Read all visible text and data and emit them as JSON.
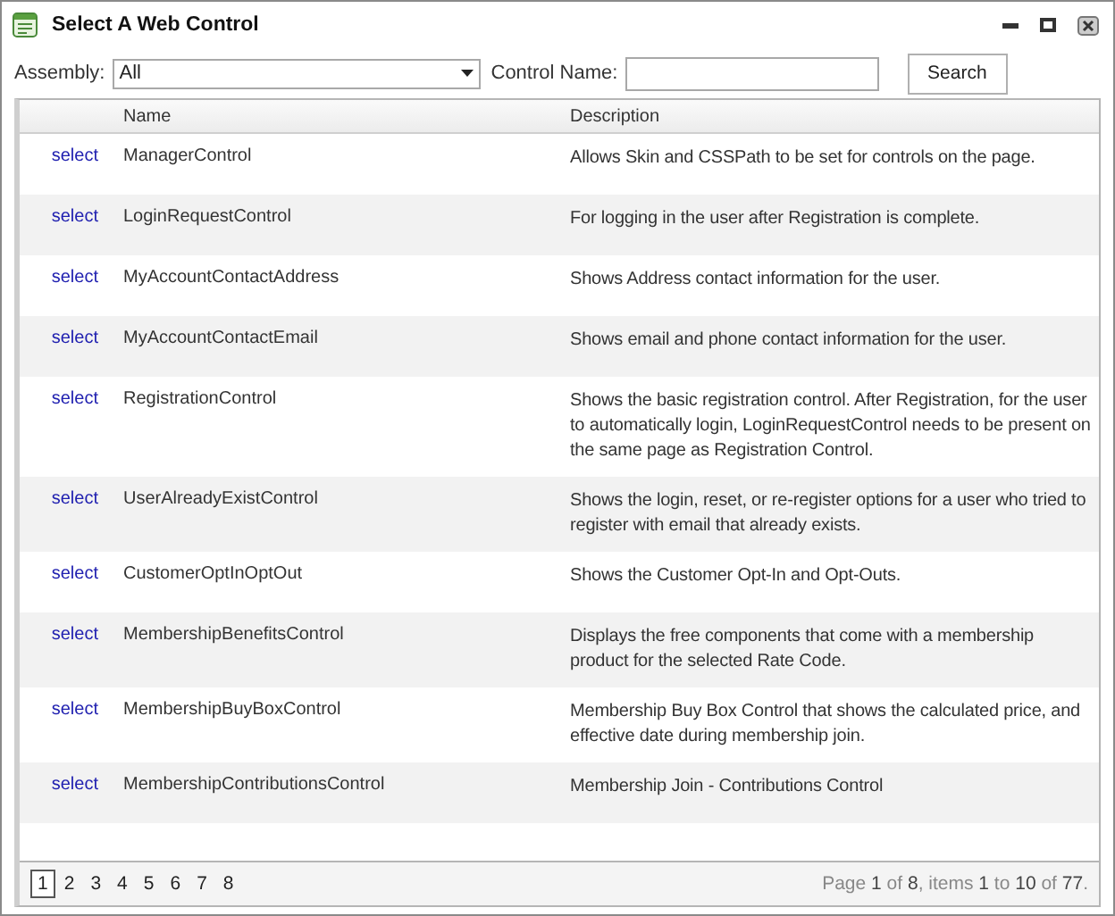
{
  "window": {
    "title": "Select A Web Control"
  },
  "filter": {
    "assembly_label": "Assembly:",
    "assembly_value": "All",
    "control_name_label": "Control Name:",
    "search_button": "Search"
  },
  "table": {
    "columns": [
      "Name",
      "Description"
    ],
    "rows": [
      {
        "action": "select",
        "name": "ManagerControl",
        "description": "Allows Skin and CSSPath to be set for controls on the page."
      },
      {
        "action": "select",
        "name": "LoginRequestControl",
        "description": "For logging in the user after Registration is complete."
      },
      {
        "action": "select",
        "name": "MyAccountContactAddress",
        "description": "Shows Address contact information for the user."
      },
      {
        "action": "select",
        "name": "MyAccountContactEmail",
        "description": "Shows email and phone contact information for the user."
      },
      {
        "action": "select",
        "name": "RegistrationControl",
        "description": "Shows the basic registration control. After Registration, for the user to automatically login, LoginRequestControl needs to be present on the same page as Registration Control."
      },
      {
        "action": "select",
        "name": "UserAlreadyExistControl",
        "description": "Shows the login, reset, or re-register options for a user who tried to register with email that already exists."
      },
      {
        "action": "select",
        "name": "CustomerOptInOptOut",
        "description": "Shows the Customer Opt-In and Opt-Outs."
      },
      {
        "action": "select",
        "name": "MembershipBenefitsControl",
        "description": "Displays the free components that come with a membership product for the selected Rate Code."
      },
      {
        "action": "select",
        "name": "MembershipBuyBoxControl",
        "description": "Membership Buy Box Control that shows the calculated price, and effective date during membership join."
      },
      {
        "action": "select",
        "name": "MembershipContributionsControl",
        "description": "Membership Join - Contributions Control"
      }
    ]
  },
  "pager": {
    "pages": [
      {
        "label": "1",
        "selected": true
      },
      {
        "label": "2",
        "selected": false
      },
      {
        "label": "3",
        "selected": false
      },
      {
        "label": "4",
        "selected": false
      },
      {
        "label": "5",
        "selected": false
      },
      {
        "label": "6",
        "selected": false
      },
      {
        "label": "7",
        "selected": false
      },
      {
        "label": "8",
        "selected": false
      }
    ],
    "info": "Page **1** of **8**, items **1** to **10** of **77**."
  }
}
